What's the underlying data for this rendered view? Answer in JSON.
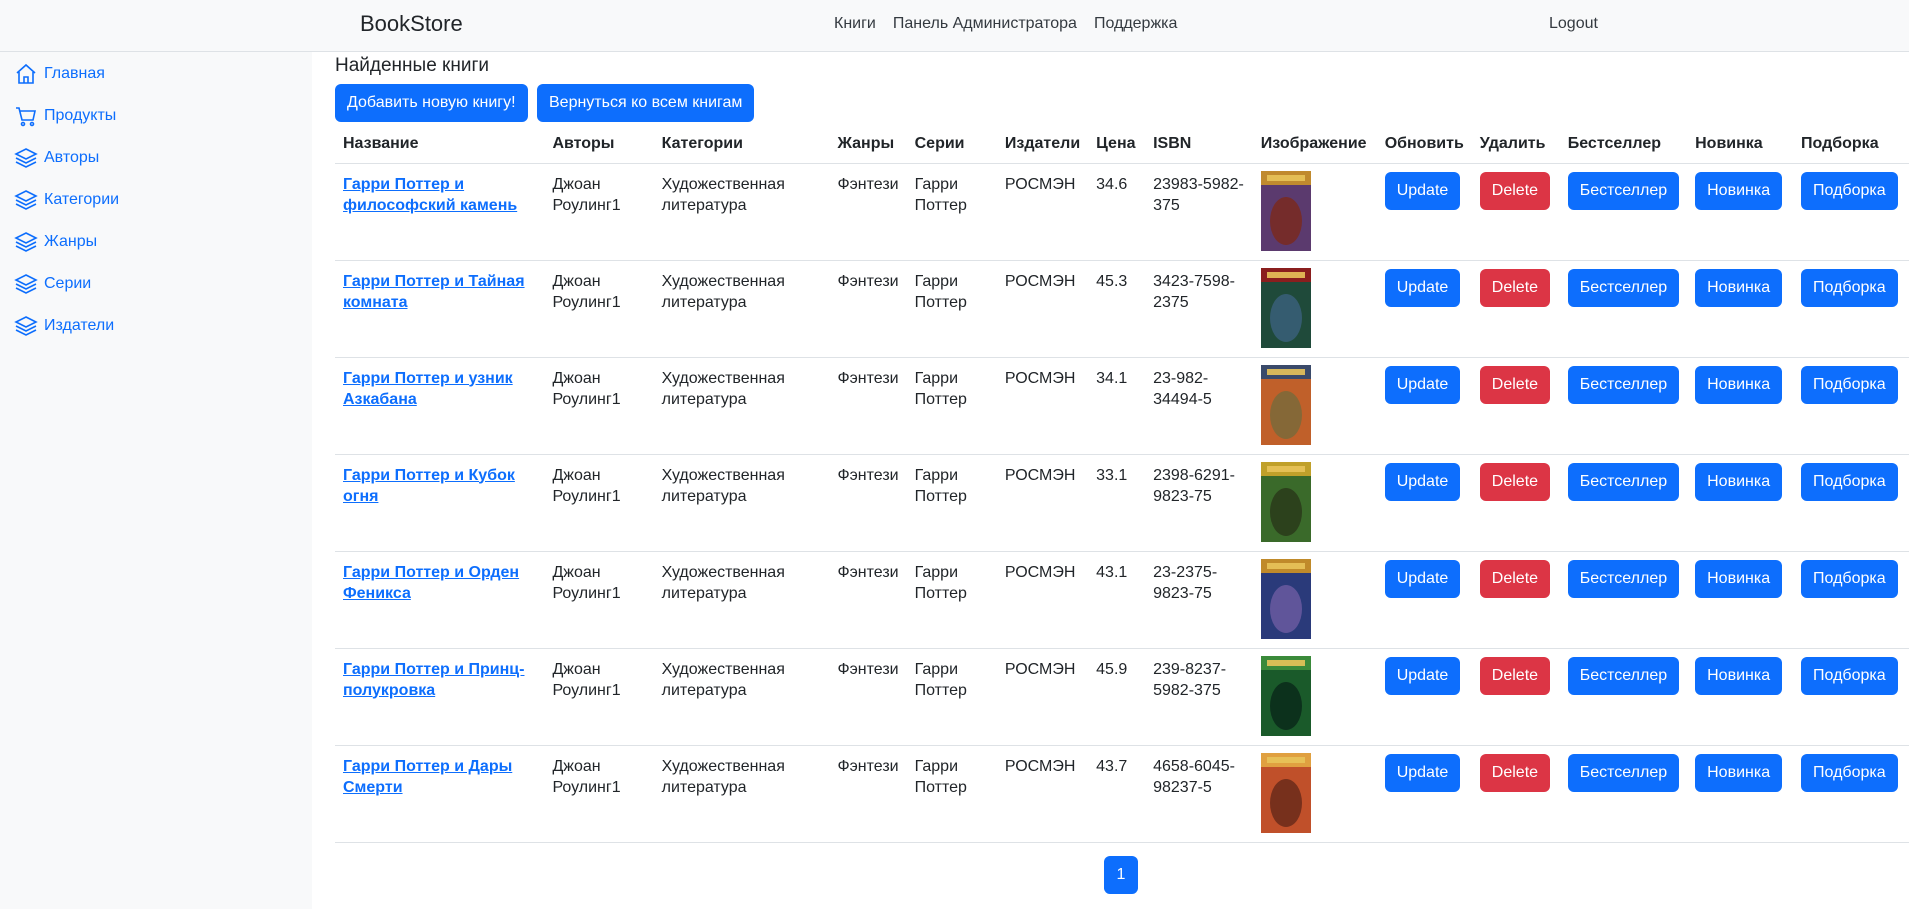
{
  "header": {
    "brand": "BookStore",
    "nav": [
      "Книги",
      "Панель Администратора",
      "Поддержка"
    ],
    "logout": "Logout"
  },
  "sidebar": {
    "items": [
      {
        "label": "Главная",
        "icon": "home-icon"
      },
      {
        "label": "Продукты",
        "icon": "cart-icon"
      },
      {
        "label": "Авторы",
        "icon": "layers-icon"
      },
      {
        "label": "Категории",
        "icon": "layers-icon"
      },
      {
        "label": "Жанры",
        "icon": "layers-icon"
      },
      {
        "label": "Серии",
        "icon": "layers-icon"
      },
      {
        "label": "Издатели",
        "icon": "layers-icon"
      }
    ]
  },
  "main": {
    "title": "Найденные книги",
    "add_button": "Добавить новую книгу!",
    "back_button": "Вернуться ко всем книгам",
    "columns": [
      "Название",
      "Авторы",
      "Категории",
      "Жанры",
      "Серии",
      "Издатели",
      "Цена",
      "ISBN",
      "Изображение",
      "Обновить",
      "Удалить",
      "Бестселлер",
      "Новинка",
      "Подборка"
    ],
    "action_labels": {
      "update": "Update",
      "delete": "Delete",
      "bestseller": "Бестселлер",
      "new": "Новинка",
      "collection": "Подборка"
    },
    "rows": [
      {
        "title": "Гарри Поттер и философский камень",
        "author": "Джоан Роулинг1",
        "category": "Художественная литература",
        "genre": "Фэнтези",
        "series": "Гарри Поттер",
        "publisher": "РОСМЭН",
        "price": "34.6",
        "isbn": "23983-5982-375",
        "cover_colors": [
          "#5b3a6e",
          "#c08a2e",
          "#7a2a20"
        ]
      },
      {
        "title": "Гарри Поттер и Тайная комната",
        "author": "Джоан Роулинг1",
        "category": "Художественная литература",
        "genre": "Фэнтези",
        "series": "Гарри Поттер",
        "publisher": "РОСМЭН",
        "price": "45.3",
        "isbn": "3423-7598-2375",
        "cover_colors": [
          "#1f4a3a",
          "#8a1e1e",
          "#3a5f7a"
        ]
      },
      {
        "title": "Гарри Поттер и узник Азкабана",
        "author": "Джоан Роулинг1",
        "category": "Художественная литература",
        "genre": "Фэнтези",
        "series": "Гарри Поттер",
        "publisher": "РОСМЭН",
        "price": "34.1",
        "isbn": "23-982-34494-5",
        "cover_colors": [
          "#c0602a",
          "#3a4a6a",
          "#7a6a3a"
        ]
      },
      {
        "title": "Гарри Поттер и Кубок огня",
        "author": "Джоан Роулинг1",
        "category": "Художественная литература",
        "genre": "Фэнтези",
        "series": "Гарри Поттер",
        "publisher": "РОСМЭН",
        "price": "33.1",
        "isbn": "2398-6291-9823-75",
        "cover_colors": [
          "#3a6a2a",
          "#c0a02a",
          "#2a3a1a"
        ]
      },
      {
        "title": "Гарри Поттер и Орден Феникса",
        "author": "Джоан Роулинг1",
        "category": "Художественная литература",
        "genre": "Фэнтези",
        "series": "Гарри Поттер",
        "publisher": "РОСМЭН",
        "price": "43.1",
        "isbn": "23-2375-9823-75",
        "cover_colors": [
          "#2a3a7a",
          "#c08a2a",
          "#6a5aa0"
        ]
      },
      {
        "title": "Гарри Поттер и Принц-полукровка",
        "author": "Джоан Роулинг1",
        "category": "Художественная литература",
        "genre": "Фэнтези",
        "series": "Гарри Поттер",
        "publisher": "РОСМЭН",
        "price": "45.9",
        "isbn": "239-8237-5982-375",
        "cover_colors": [
          "#1a5a2a",
          "#3a8a3a",
          "#0a2a1a"
        ]
      },
      {
        "title": "Гарри Поттер и Дары Смерти",
        "author": "Джоан Роулинг1",
        "category": "Художественная литература",
        "genre": "Фэнтези",
        "series": "Гарри Поттер",
        "publisher": "РОСМЭН",
        "price": "43.7",
        "isbn": "4658-6045-98237-5",
        "cover_colors": [
          "#c0502a",
          "#e0a040",
          "#6a2a1a"
        ]
      }
    ]
  },
  "pagination": {
    "current": "1"
  }
}
